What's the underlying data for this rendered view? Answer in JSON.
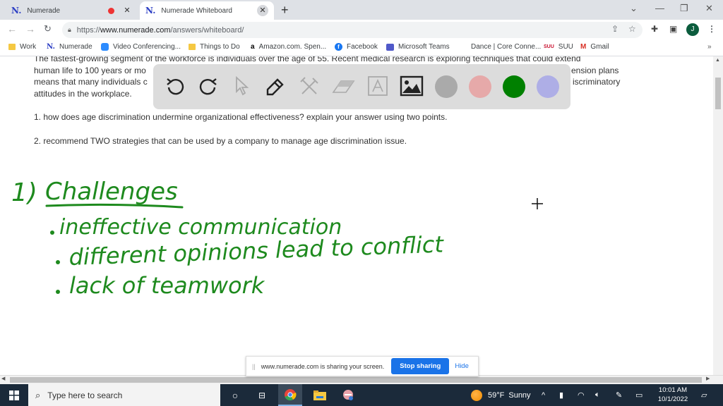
{
  "browser": {
    "tabs": [
      {
        "label": "Numerade",
        "favicon": "N.",
        "recording": true,
        "active": false
      },
      {
        "label": "Numerade Whiteboard",
        "favicon": "N.",
        "recording": false,
        "active": true
      }
    ],
    "new_tab": "+",
    "window_controls": {
      "dropdown": "⌄",
      "minimize": "—",
      "restore": "❐",
      "close": "✕"
    },
    "nav": {
      "back": "←",
      "forward": "→",
      "reload": "C"
    },
    "url": {
      "scheme": "https://",
      "host": "www.numerade.com",
      "path": "/answers/whiteboard/"
    },
    "profile_initial": "J",
    "bookmarks": [
      {
        "label": "Work",
        "icon": "folder"
      },
      {
        "label": "Numerade",
        "icon": "numerade"
      },
      {
        "label": "Video Conferencing...",
        "icon": "zoom"
      },
      {
        "label": "Things to Do",
        "icon": "folder"
      },
      {
        "label": "Amazon.com. Spen...",
        "icon": "amazon"
      },
      {
        "label": "Facebook",
        "icon": "facebook"
      },
      {
        "label": "Microsoft Teams",
        "icon": "teams"
      },
      {
        "label": "Dance | Core Conne...",
        "icon": "none"
      },
      {
        "label": "SUU",
        "icon": "suu"
      },
      {
        "label": "Gmail",
        "icon": "gmail"
      }
    ],
    "bookmarks_overflow": "»"
  },
  "question": {
    "paragraph_lines": [
      "The fastest-growing segment of the workforce is individuals over the age of 55. Recent medical research is exploring techniques that could extend",
      "human life to 100 years or mo",
      "means that many individuals c",
      "attitudes in the workplace."
    ],
    "paragraph_right_fragments": [
      "ension plans",
      "iscriminatory"
    ],
    "q1": "1. how does age discrimination undermine organizational effectiveness? explain your answer using two points.",
    "q2": "2. recommend TWO strategies that can be used by a company to manage age discrimination issue."
  },
  "toolbar": {
    "tools": [
      {
        "name": "undo",
        "enabled": true
      },
      {
        "name": "redo",
        "enabled": true
      },
      {
        "name": "select",
        "enabled": false
      },
      {
        "name": "pen",
        "enabled": true
      },
      {
        "name": "shapes",
        "enabled": false
      },
      {
        "name": "eraser",
        "enabled": false
      },
      {
        "name": "text",
        "enabled": false
      },
      {
        "name": "image",
        "enabled": true
      }
    ],
    "colors": [
      "#aaaaaa",
      "#e6a9a9",
      "#008000",
      "#aeaee6"
    ],
    "selected_color": "#008000"
  },
  "handwriting": {
    "color": "#1e8a1e",
    "heading_number": "1)",
    "heading": "Challenges",
    "bullets": [
      "ineffective communication",
      "different opinions lead to conflict",
      "lack of teamwork"
    ]
  },
  "share_bar": {
    "message": "www.numerade.com is sharing your screen.",
    "stop_label": "Stop sharing",
    "hide_label": "Hide"
  },
  "taskbar": {
    "search_placeholder": "Type here to search",
    "weather": {
      "temp": "59°F",
      "condition": "Sunny"
    },
    "time": "10:01 AM",
    "date": "10/1/2022"
  }
}
